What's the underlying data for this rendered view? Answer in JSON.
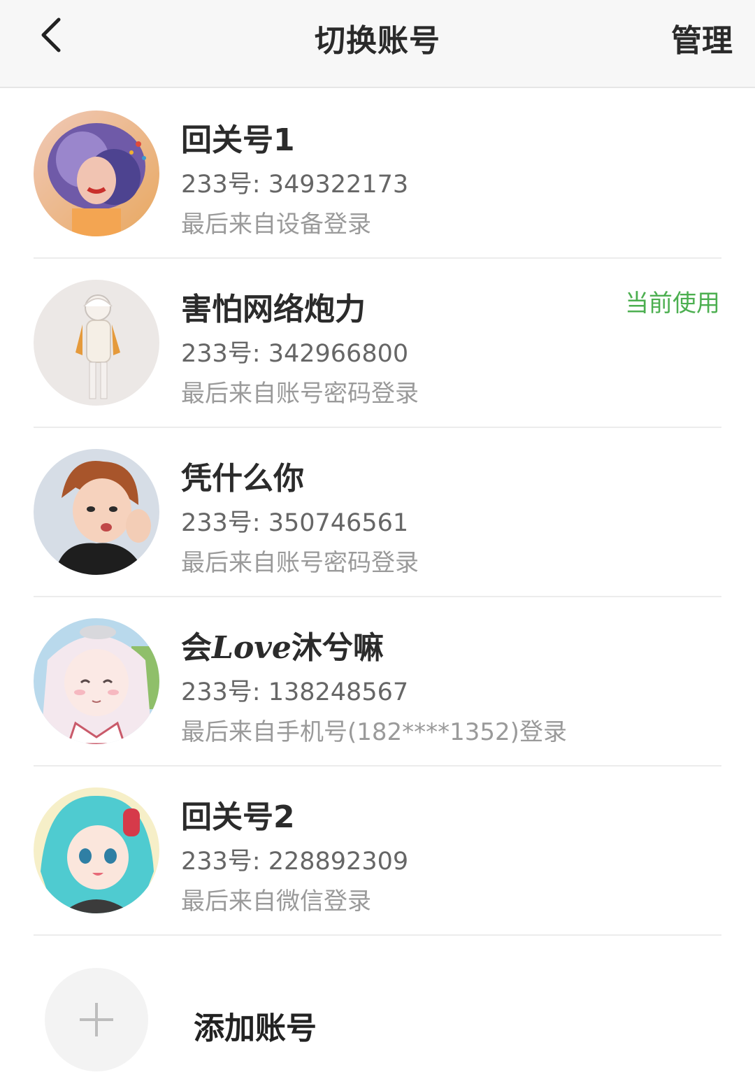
{
  "header": {
    "title": "切换账号",
    "manage_label": "管理",
    "back_icon": "chevron-left-icon"
  },
  "accounts": [
    {
      "name": "回关号1",
      "uid": "233号: 349322173",
      "login": "最后来自设备登录",
      "current": false,
      "avatar_bg": "#8f6cc0"
    },
    {
      "name": "害怕网络炮力",
      "uid": "233号: 342966800",
      "login": "最后来自账号密码登录",
      "current": true,
      "current_label": "当前使用",
      "avatar_bg": "#ece8e6"
    },
    {
      "name": "凭什么你",
      "uid": "233号: 350746561",
      "login": "最后来自账号密码登录",
      "current": false,
      "avatar_bg": "#d6dde6"
    },
    {
      "name_prefix": "会",
      "name_love": "Love",
      "name_suffix": "沐兮嘛",
      "uid": "233号: 138248567",
      "login": "最后来自手机号(182****1352)登录",
      "current": false,
      "avatar_bg": "#f3e6ea"
    },
    {
      "name": "回关号2",
      "uid": "233号: 228892309",
      "login": "最后来自微信登录",
      "current": false,
      "avatar_bg": "#7fd6d8"
    }
  ],
  "add_account": {
    "label": "添加账号",
    "icon": "plus-icon"
  },
  "colors": {
    "accent_green": "#4caf50",
    "header_bg": "#f7f7f7",
    "divider": "#ececec"
  }
}
